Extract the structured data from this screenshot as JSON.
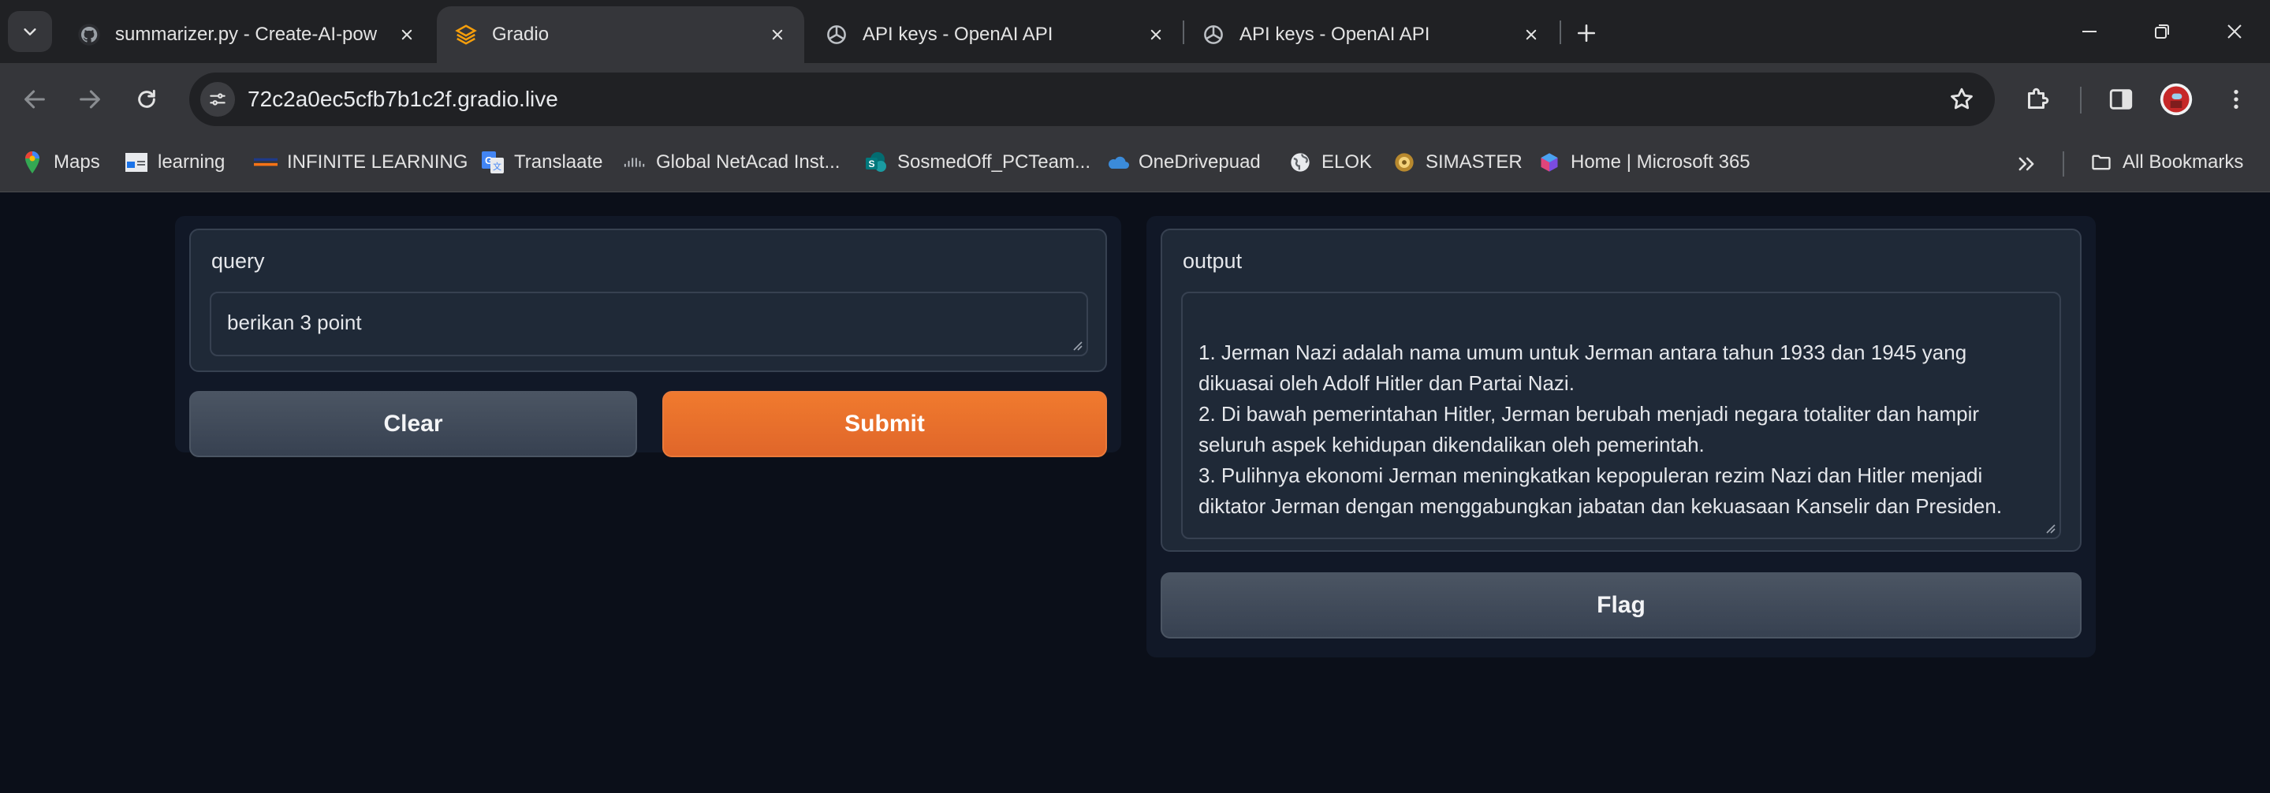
{
  "browser": {
    "tabs": [
      {
        "title": "summarizer.py - Create-AI-pow",
        "favicon": "github-icon",
        "active": false
      },
      {
        "title": "Gradio",
        "favicon": "gradio-icon",
        "active": true
      },
      {
        "title": "API keys - OpenAI API",
        "favicon": "openai-icon",
        "active": false
      },
      {
        "title": "API keys - OpenAI API",
        "favicon": "openai-icon",
        "active": false
      }
    ],
    "url": "72c2a0ec5cfb7b1c2f.gradio.live",
    "bookmarks": [
      {
        "label": "Maps",
        "icon": "maps-pin-icon"
      },
      {
        "label": "learning",
        "icon": "learning-icon"
      },
      {
        "label": "INFINITE LEARNING",
        "icon": "infinite-learning-icon"
      },
      {
        "label": "Translaate",
        "icon": "translate-icon"
      },
      {
        "label": "Global NetAcad Inst...",
        "icon": "cisco-icon"
      },
      {
        "label": "SosmedOff_PCTeam...",
        "icon": "sharepoint-icon"
      },
      {
        "label": "OneDrivepuad",
        "icon": "onedrive-icon"
      },
      {
        "label": "ELOK",
        "icon": "globe-icon"
      },
      {
        "label": "SIMASTER",
        "icon": "simaster-icon"
      },
      {
        "label": "Home | Microsoft 365",
        "icon": "microsoft365-icon"
      }
    ],
    "all_bookmarks_label": "All Bookmarks"
  },
  "app": {
    "input": {
      "label": "query",
      "value": "berikan 3 point"
    },
    "buttons": {
      "clear": "Clear",
      "submit": "Submit",
      "flag": "Flag"
    },
    "output": {
      "label": "output",
      "lines": [
        "1. Jerman Nazi adalah nama umum untuk Jerman antara tahun 1933 dan 1945 yang",
        "dikuasai oleh Adolf Hitler dan Partai Nazi.",
        "2. Di bawah pemerintahan Hitler, Jerman berubah menjadi negara totaliter dan hampir",
        "seluruh aspek kehidupan dikendalikan oleh pemerintah.",
        "3. Pulihnya ekonomi Jerman meningkatkan kepopuleran rezim Nazi dan Hitler menjadi",
        "diktator Jerman dengan menggabungkan jabatan dan kekuasaan Kanselir dan Presiden."
      ]
    }
  },
  "colors": {
    "page_bg": "#0b0f19",
    "panel_bg": "#111827",
    "block_bg": "#1f2937",
    "primary": "#e8702d",
    "secondary": "#4b5563"
  }
}
